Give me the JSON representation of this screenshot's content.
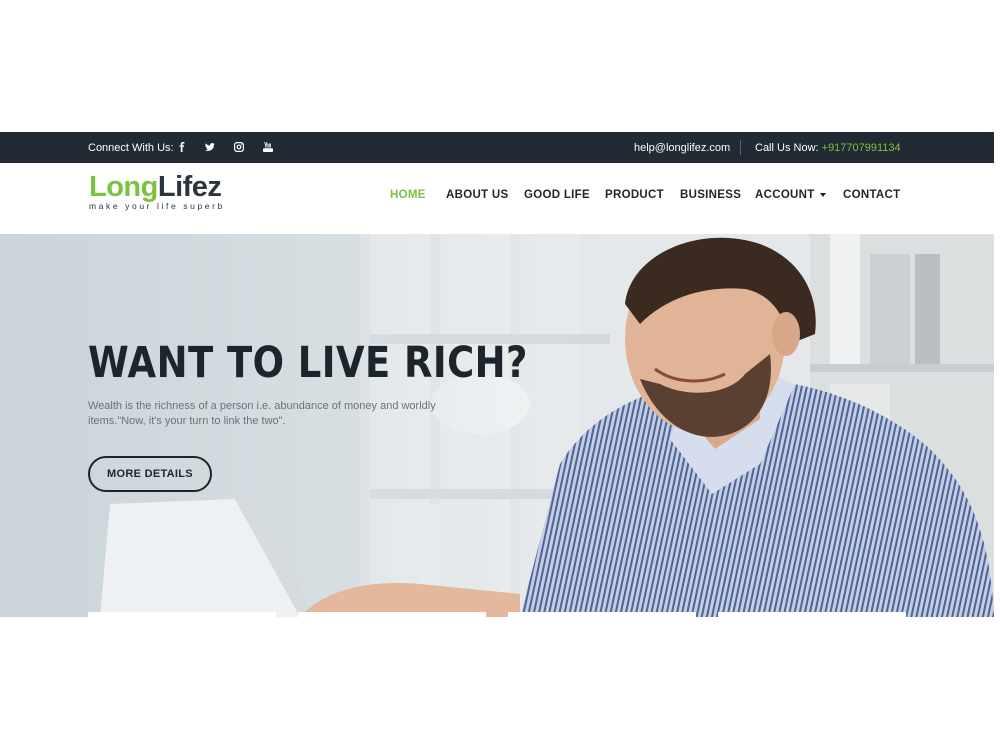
{
  "topbar": {
    "connect_label": "Connect With Us:",
    "social": [
      "facebook-icon",
      "twitter-icon",
      "instagram-icon",
      "youtube-icon"
    ],
    "email": "help@longlifez.com",
    "call_label": "Call Us Now:",
    "phone": "+917707991134"
  },
  "logo": {
    "part1": "Long",
    "part2": "Lifez",
    "tagline": "make your life superb"
  },
  "nav": {
    "items": [
      "HOME",
      "ABOUT US",
      "GOOD LIFE",
      "PRODUCT",
      "BUSINESS",
      "ACCOUNT",
      "CONTACT"
    ],
    "active": "HOME"
  },
  "hero": {
    "title": "WANT TO LIVE RICH?",
    "text": "Wealth is the richness of a person i.e. abundance of money and worldly items.\"Now, it's your turn to link the two\".",
    "button": "MORE DETAILS"
  },
  "colors": {
    "accent": "#7dc241",
    "dark": "#222a33"
  }
}
